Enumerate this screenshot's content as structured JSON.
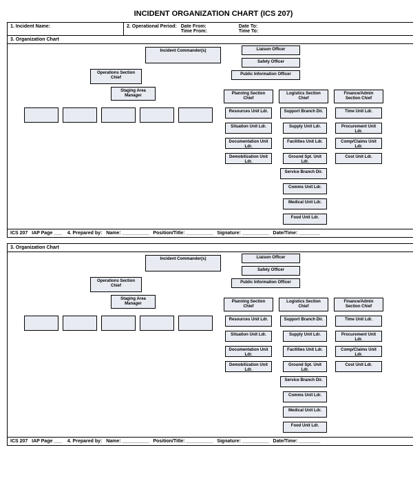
{
  "title": "INCIDENT ORGANIZATION CHART (ICS 207)",
  "hdr": {
    "f1": "1. Incident Name:",
    "f2": "2. Operational Period:",
    "df": "Date From:",
    "tf": "Time From:",
    "dt": "Date To:",
    "tt": "Time To:"
  },
  "f3": "3. Organization Chart",
  "boxes": {
    "ic": "Incident Commander(s)",
    "lo": "Liaison Officer",
    "so": "Safety Officer",
    "pio": "Public Information Officer",
    "osc": "Operations Section Chief",
    "sam": "Staging Area Manager",
    "psc": "Planning Section Chief",
    "lsc": "Logistics Section Chief",
    "fasc": "Finance/Admin Section Chief",
    "ru": "Resources Unit Ldr.",
    "su": "Situation Unit Ldr.",
    "du": "Documentation Unit Ldr.",
    "dm": "Demobilization Unit Ldr.",
    "sbd": "Support Branch Dir.",
    "spl": "Supply Unit Ldr.",
    "ful": "Facilities Unit Ldr.",
    "gsl": "Ground Spt. Unit Ldr.",
    "svb": "Service Branch Dir.",
    "cul": "Comms Unit Ldr.",
    "mul": "Medical Unit Ldr.",
    "fol": "Food Unit Ldr.",
    "tul": "Time Unit Ldr.",
    "pul": "Procurement Unit Ldr.",
    "ccl": "Comp/Claims Unit Ldr.",
    "col": "Cost Unit Ldr."
  },
  "footer": {
    "ics": "ICS 207",
    "iap": "IAP Page ___",
    "f4": "4. Prepared by:",
    "nm": "Name:",
    "pt": "Position/Title:",
    "sg": "Signature:",
    "dt": "Date/Time:"
  }
}
